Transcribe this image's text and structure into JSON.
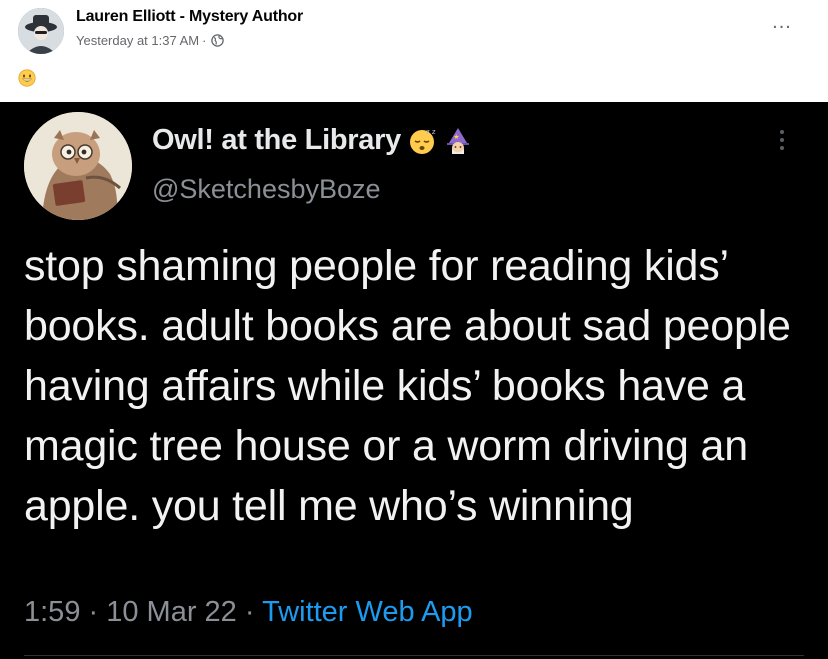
{
  "facebook_post": {
    "author_name": "Lauren Elliott - Mystery Author",
    "timestamp": "Yesterday at 1:37 AM",
    "separator": "·",
    "privacy_icon": "globe-icon",
    "more_options_icon": "more-horizontal-icon",
    "more_label": "...",
    "body_emoji": "grinning-face-emoji"
  },
  "tweet": {
    "display_name": "Owl! at the Library",
    "name_emojis": [
      "sleeping-face-emoji",
      "mage-emoji"
    ],
    "handle": "@SketchesbyBoze",
    "more_icon": "more-vertical-icon",
    "text": "stop shaming people for reading kids’ books. adult books are about sad people having affairs while kids’ books have a magic tree house or a worm driving an apple. you tell me who’s winning",
    "time": "1:59",
    "date": "10 Mar 22",
    "dot": " · ",
    "source": "Twitter Web App"
  },
  "colors": {
    "tweet_background": "#000000",
    "tweet_text": "#f2f2f2",
    "tweet_secondary": "#8b9096",
    "tweet_link": "#1d9bf0",
    "fb_text": "#050505",
    "fb_secondary": "#65676b"
  }
}
